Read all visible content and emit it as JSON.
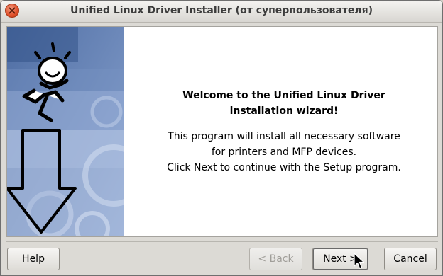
{
  "window": {
    "title": "Unified Linux Driver Installer (от суперпользователя)"
  },
  "wizard": {
    "heading_line1": "Welcome to the Unified Linux Driver",
    "heading_line2": "installation wizard!",
    "body_line1": "This program will install all necessary software",
    "body_line2": "for printers and MFP devices.",
    "body_line3": "Click Next to continue with the Setup program."
  },
  "buttons": {
    "help": {
      "mnemonic": "H",
      "rest": "elp"
    },
    "back": {
      "prefix": "< ",
      "mnemonic": "B",
      "rest": "ack",
      "enabled": false
    },
    "next": {
      "mnemonic": "N",
      "rest": "ext >"
    },
    "cancel": {
      "mnemonic": "C",
      "rest": "ancel"
    }
  },
  "icons": {
    "close": "close-icon",
    "side_image": "installer-mascot-arrow-illustration",
    "cursor": "mouse-pointer-icon"
  },
  "colors": {
    "side_panel": "#5b79ad",
    "close_button": "#e0502a"
  }
}
